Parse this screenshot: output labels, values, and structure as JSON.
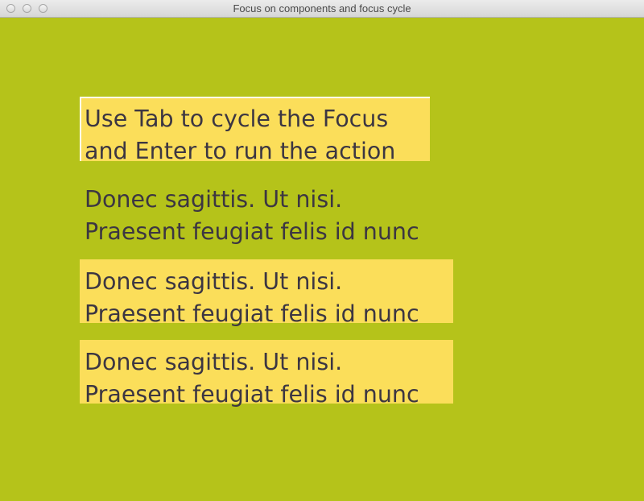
{
  "window": {
    "title": "Focus on components and focus cycle"
  },
  "colors": {
    "background": "#b5c31a",
    "highlight": "#fbde5a",
    "text": "#3c3642",
    "focus_border": "#ffffff"
  },
  "labels": [
    {
      "lines": [
        "Use Tab to cycle the Focus",
        "and Enter to run the action"
      ],
      "highlighted": true,
      "focused": true
    },
    {
      "lines": [
        "Donec sagittis. Ut nisi.",
        "Praesent feugiat felis id nunc"
      ],
      "highlighted": false,
      "focused": false
    },
    {
      "lines": [
        "Donec sagittis. Ut nisi.",
        "Praesent feugiat felis id nunc"
      ],
      "highlighted": true,
      "focused": false
    },
    {
      "lines": [
        "Donec sagittis. Ut nisi.",
        "Praesent feugiat felis id nunc"
      ],
      "highlighted": true,
      "focused": false
    }
  ]
}
